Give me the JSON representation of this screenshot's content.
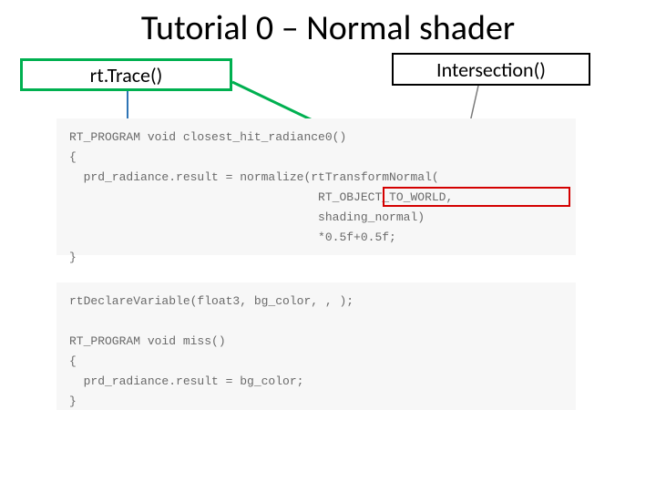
{
  "title": "Tutorial 0 – Normal shader",
  "boxes": {
    "trace": "rt.Trace()",
    "intersection": "Intersection()"
  },
  "code": {
    "block1": {
      "l1": "RT_PROGRAM void closest_hit_radiance0()",
      "l2": "{",
      "l3": "  prd_radiance.result = normalize(rtTransformNormal(",
      "l4": "                                   RT_OBJECT_TO_WORLD,",
      "l5": "                                   shading_normal)",
      "l6": "                                   *0.5f+0.5f;",
      "l7": "}"
    },
    "block2": {
      "l1": "rtDeclareVariable(float3, bg_color, , );",
      "l2": "",
      "l3": "RT_PROGRAM void miss()",
      "l4": "{",
      "l5": "  prd_radiance.result = bg_color;",
      "l6": "}"
    }
  }
}
